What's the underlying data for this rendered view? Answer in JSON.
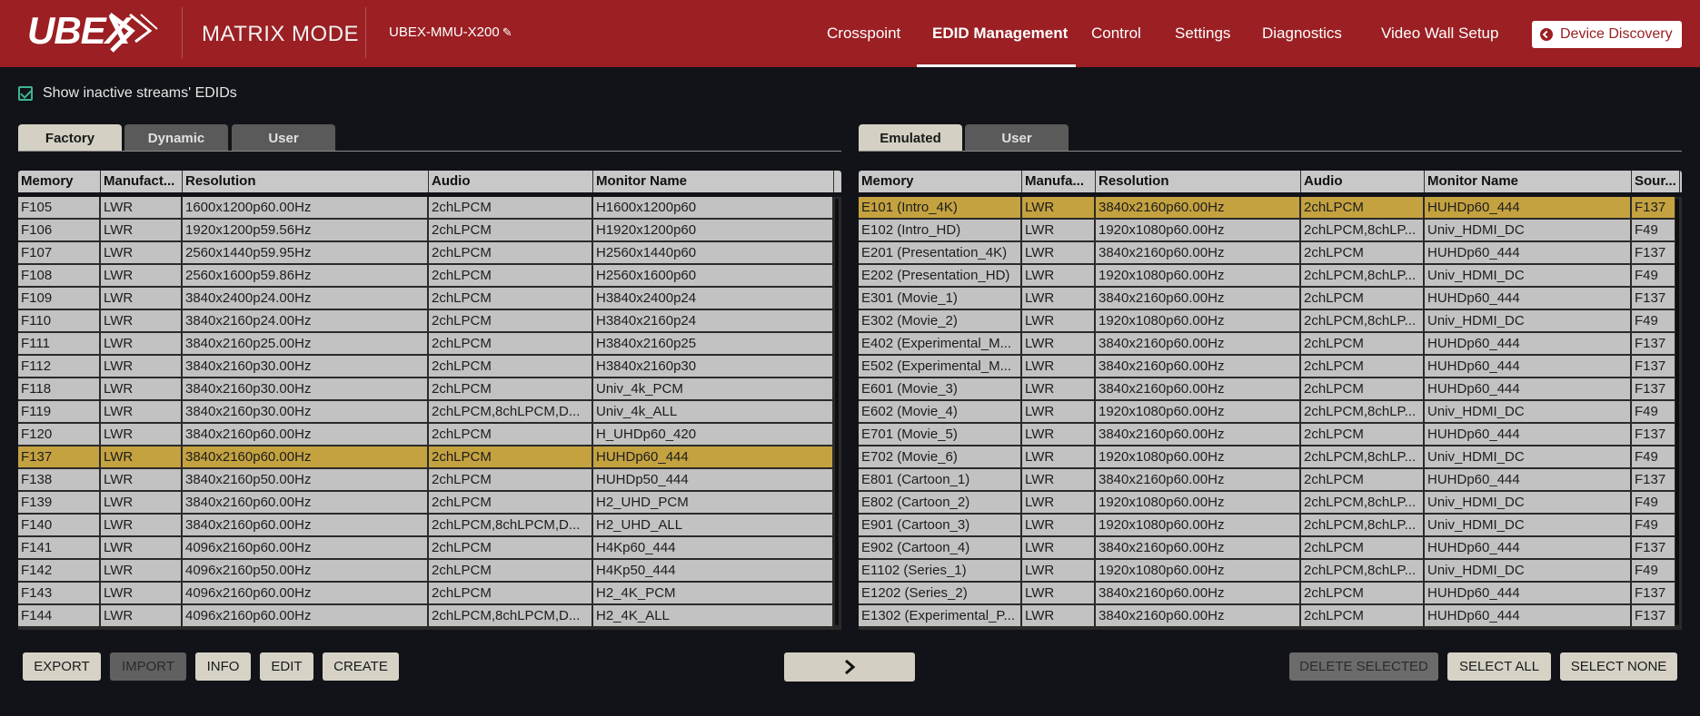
{
  "header": {
    "logo_text": "UBEX",
    "mode": "MATRIX MODE",
    "device_name": "UBEX-MMU-X200",
    "nav": [
      "Crosspoint",
      "EDID Management",
      "Control",
      "Settings",
      "Diagnostics",
      "Video Wall Setup"
    ],
    "active_nav": "EDID Management",
    "discover_label": "Device Discovery",
    "brand_color": "#9b1f23"
  },
  "options": {
    "show_inactive_label": "Show inactive streams' EDIDs",
    "show_inactive_checked": true
  },
  "left": {
    "tabs": [
      "Factory",
      "Dynamic",
      "User"
    ],
    "active_tab": "Factory",
    "columns": [
      "Memory",
      "Manufact...",
      "Resolution",
      "Audio",
      "Monitor Name"
    ],
    "rows": [
      [
        "F105",
        "LWR",
        "1600x1200p60.00Hz",
        "2chLPCM",
        "H1600x1200p60"
      ],
      [
        "F106",
        "LWR",
        "1920x1200p59.56Hz",
        "2chLPCM",
        "H1920x1200p60"
      ],
      [
        "F107",
        "LWR",
        "2560x1440p59.95Hz",
        "2chLPCM",
        "H2560x1440p60"
      ],
      [
        "F108",
        "LWR",
        "2560x1600p59.86Hz",
        "2chLPCM",
        "H2560x1600p60"
      ],
      [
        "F109",
        "LWR",
        "3840x2400p24.00Hz",
        "2chLPCM",
        "H3840x2400p24"
      ],
      [
        "F110",
        "LWR",
        "3840x2160p24.00Hz",
        "2chLPCM",
        "H3840x2160p24"
      ],
      [
        "F111",
        "LWR",
        "3840x2160p25.00Hz",
        "2chLPCM",
        "H3840x2160p25"
      ],
      [
        "F112",
        "LWR",
        "3840x2160p30.00Hz",
        "2chLPCM",
        "H3840x2160p30"
      ],
      [
        "F118",
        "LWR",
        "3840x2160p30.00Hz",
        "2chLPCM",
        "Univ_4k_PCM"
      ],
      [
        "F119",
        "LWR",
        "3840x2160p30.00Hz",
        "2chLPCM,8chLPCM,D...",
        "Univ_4k_ALL"
      ],
      [
        "F120",
        "LWR",
        "3840x2160p60.00Hz",
        "2chLPCM",
        "H_UHDp60_420"
      ],
      [
        "F137",
        "LWR",
        "3840x2160p60.00Hz",
        "2chLPCM",
        "HUHDp60_444"
      ],
      [
        "F138",
        "LWR",
        "3840x2160p50.00Hz",
        "2chLPCM",
        "HUHDp50_444"
      ],
      [
        "F139",
        "LWR",
        "3840x2160p60.00Hz",
        "2chLPCM",
        "H2_UHD_PCM"
      ],
      [
        "F140",
        "LWR",
        "3840x2160p60.00Hz",
        "2chLPCM,8chLPCM,D...",
        "H2_UHD_ALL"
      ],
      [
        "F141",
        "LWR",
        "4096x2160p60.00Hz",
        "2chLPCM",
        "H4Kp60_444"
      ],
      [
        "F142",
        "LWR",
        "4096x2160p50.00Hz",
        "2chLPCM",
        "H4Kp50_444"
      ],
      [
        "F143",
        "LWR",
        "4096x2160p60.00Hz",
        "2chLPCM",
        "H2_4K_PCM"
      ],
      [
        "F144",
        "LWR",
        "4096x2160p60.00Hz",
        "2chLPCM,8chLPCM,D...",
        "H2_4K_ALL"
      ]
    ],
    "selected_row": 11
  },
  "right": {
    "tabs": [
      "Emulated",
      "User"
    ],
    "active_tab": "Emulated",
    "columns": [
      "Memory",
      "Manufa...",
      "Resolution",
      "Audio",
      "Monitor Name",
      "Sour..."
    ],
    "rows": [
      [
        "E101 (Intro_4K)",
        "LWR",
        "3840x2160p60.00Hz",
        "2chLPCM",
        "HUHDp60_444",
        "F137"
      ],
      [
        "E102 (Intro_HD)",
        "LWR",
        "1920x1080p60.00Hz",
        "2chLPCM,8chLP...",
        "Univ_HDMI_DC",
        "F49"
      ],
      [
        "E201 (Presentation_4K)",
        "LWR",
        "3840x2160p60.00Hz",
        "2chLPCM",
        "HUHDp60_444",
        "F137"
      ],
      [
        "E202 (Presentation_HD)",
        "LWR",
        "1920x1080p60.00Hz",
        "2chLPCM,8chLP...",
        "Univ_HDMI_DC",
        "F49"
      ],
      [
        "E301 (Movie_1)",
        "LWR",
        "3840x2160p60.00Hz",
        "2chLPCM",
        "HUHDp60_444",
        "F137"
      ],
      [
        "E302 (Movie_2)",
        "LWR",
        "1920x1080p60.00Hz",
        "2chLPCM,8chLP...",
        "Univ_HDMI_DC",
        "F49"
      ],
      [
        "E402 (Experimental_M...",
        "LWR",
        "3840x2160p60.00Hz",
        "2chLPCM",
        "HUHDp60_444",
        "F137"
      ],
      [
        "E502 (Experimental_M...",
        "LWR",
        "3840x2160p60.00Hz",
        "2chLPCM",
        "HUHDp60_444",
        "F137"
      ],
      [
        "E601 (Movie_3)",
        "LWR",
        "3840x2160p60.00Hz",
        "2chLPCM",
        "HUHDp60_444",
        "F137"
      ],
      [
        "E602 (Movie_4)",
        "LWR",
        "1920x1080p60.00Hz",
        "2chLPCM,8chLP...",
        "Univ_HDMI_DC",
        "F49"
      ],
      [
        "E701 (Movie_5)",
        "LWR",
        "3840x2160p60.00Hz",
        "2chLPCM",
        "HUHDp60_444",
        "F137"
      ],
      [
        "E702 (Movie_6)",
        "LWR",
        "1920x1080p60.00Hz",
        "2chLPCM,8chLP...",
        "Univ_HDMI_DC",
        "F49"
      ],
      [
        "E801 (Cartoon_1)",
        "LWR",
        "3840x2160p60.00Hz",
        "2chLPCM",
        "HUHDp60_444",
        "F137"
      ],
      [
        "E802 (Cartoon_2)",
        "LWR",
        "1920x1080p60.00Hz",
        "2chLPCM,8chLP...",
        "Univ_HDMI_DC",
        "F49"
      ],
      [
        "E901 (Cartoon_3)",
        "LWR",
        "1920x1080p60.00Hz",
        "2chLPCM,8chLP...",
        "Univ_HDMI_DC",
        "F49"
      ],
      [
        "E902 (Cartoon_4)",
        "LWR",
        "3840x2160p60.00Hz",
        "2chLPCM",
        "HUHDp60_444",
        "F137"
      ],
      [
        "E1102 (Series_1)",
        "LWR",
        "1920x1080p60.00Hz",
        "2chLPCM,8chLP...",
        "Univ_HDMI_DC",
        "F49"
      ],
      [
        "E1202 (Series_2)",
        "LWR",
        "3840x2160p60.00Hz",
        "2chLPCM",
        "HUHDp60_444",
        "F137"
      ],
      [
        "E1302 (Experimental_P...",
        "LWR",
        "3840x2160p60.00Hz",
        "2chLPCM",
        "HUHDp60_444",
        "F137"
      ]
    ],
    "selected_row": 0
  },
  "buttons": {
    "export": "EXPORT",
    "import": "IMPORT",
    "info": "INFO",
    "edit": "EDIT",
    "create": "CREATE",
    "transfer_icon": "chevron-right-icon",
    "delete_selected": "DELETE SELECTED",
    "select_all": "SELECT ALL",
    "select_none": "SELECT NONE"
  },
  "colors": {
    "selected_row": "#c4a240",
    "row_bg": "#c2c2c2",
    "accent_check": "#3fb58f"
  }
}
